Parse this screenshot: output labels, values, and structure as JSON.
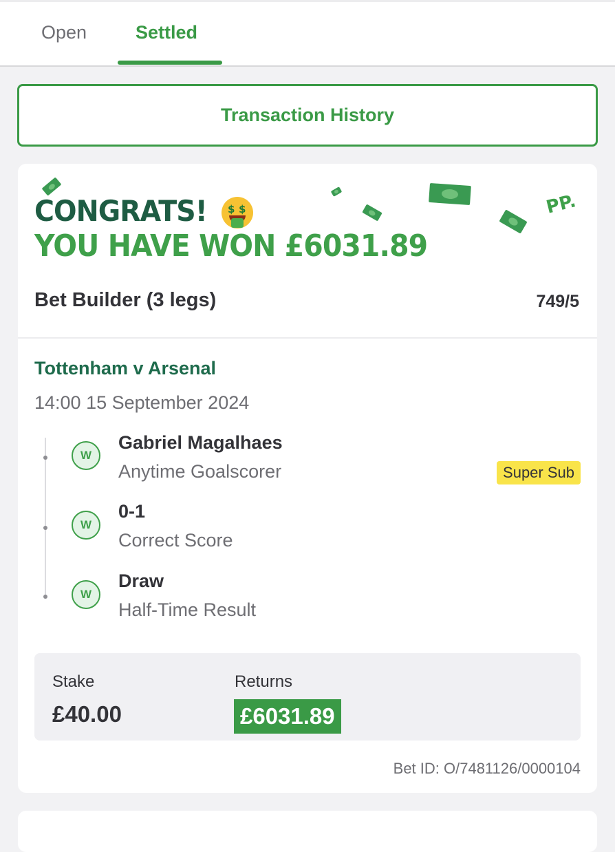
{
  "tabs": [
    {
      "label": "Open"
    },
    {
      "label": "Settled"
    }
  ],
  "transaction_history_label": "Transaction History",
  "bet_card": {
    "headline": "CONGRATS!",
    "won_text": "YOU HAVE WON £6031.89",
    "logo_text": "PP.",
    "bet_type": "Bet Builder (3 legs)",
    "odds": "749/5",
    "match": "Tottenham v Arsenal",
    "datetime": "14:00 15 September 2024",
    "legs": [
      {
        "result": "W",
        "selection": "Gabriel Magalhaes",
        "market": "Anytime Goalscorer",
        "tag": "Super Sub"
      },
      {
        "result": "W",
        "selection": "0-1",
        "market": "Correct Score"
      },
      {
        "result": "W",
        "selection": "Draw",
        "market": "Half-Time Result"
      }
    ],
    "stake_label": "Stake",
    "stake": "£40.00",
    "returns_label": "Returns",
    "returns": "£6031.89",
    "bet_id": "Bet ID: O/7481126/0000104"
  },
  "colors": {
    "accent_green": "#3a9a46",
    "dark_green": "#1e5c43",
    "super_sub_yellow": "#f9e44a"
  }
}
